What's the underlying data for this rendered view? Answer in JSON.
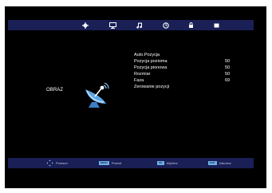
{
  "topbar": {
    "tabs": [
      {
        "icon": "gear-icon",
        "glyph": "✿"
      },
      {
        "icon": "monitor-icon",
        "glyph": "▭"
      },
      {
        "icon": "music-note-icon",
        "glyph": "♫"
      },
      {
        "icon": "clock-icon",
        "glyph": "◷"
      },
      {
        "icon": "lock-icon",
        "glyph": "■"
      },
      {
        "icon": "box-icon",
        "glyph": "■"
      }
    ]
  },
  "section": {
    "title": "OBRAZ",
    "icon": "satellite-dish-icon"
  },
  "menu": {
    "items": [
      {
        "label": "Auto.Pozycja",
        "value": ""
      },
      {
        "label": "Pozycja pozioma",
        "value": "50"
      },
      {
        "label": "Pozycja pionowa",
        "value": "50"
      },
      {
        "label": "Rozmiar",
        "value": "50"
      },
      {
        "label": "Faza",
        "value": "69"
      },
      {
        "label": "Zerowanie pozycji",
        "value": ""
      }
    ]
  },
  "footer": {
    "hints": [
      {
        "key": "",
        "icon": "arrows-icon",
        "label": "Przesuń"
      },
      {
        "key": "MENU",
        "icon": "",
        "label": "Powrót"
      },
      {
        "key": "OK",
        "icon": "",
        "label": "Wybierz"
      },
      {
        "key": "EXIT",
        "icon": "",
        "label": "Zakończ"
      }
    ]
  },
  "colors": {
    "background": "#000000",
    "bar": "#1a1f55",
    "key": "#6fb0e8",
    "dish": "#5aa6e6"
  }
}
